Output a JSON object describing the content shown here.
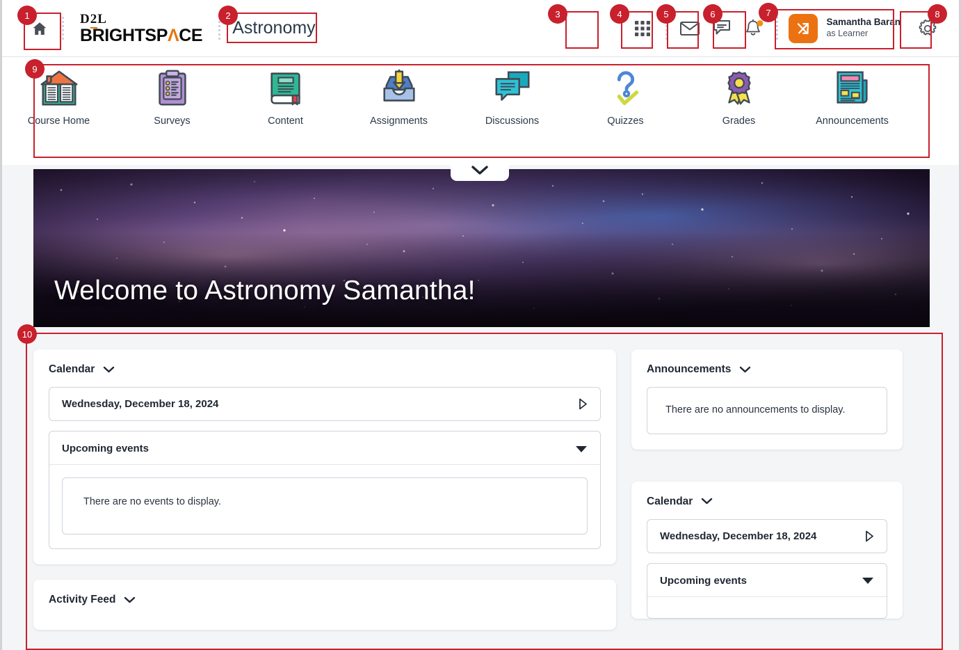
{
  "header": {
    "home_icon": "home-icon",
    "brand_top": "D2L",
    "brand_top_pre": "D",
    "brand_top_num": "2",
    "brand_top_post": "L",
    "brand_main_pre": "BRIGHTSP",
    "brand_main_acc": "A",
    "brand_main_post": "CE",
    "course_name": "Astronomy",
    "waffle_icon": "grid-apps-icon",
    "email_icon": "envelope-icon",
    "messages_icon": "chat-bubble-icon",
    "alerts_icon": "bell-icon",
    "user_name": "Samantha Baran",
    "user_role": "as Learner",
    "avatar_icon": "swap-arrows-icon",
    "settings_icon": "gear-icon"
  },
  "navbar": {
    "items": [
      {
        "label": "Course Home",
        "icon": "open-book-house-icon"
      },
      {
        "label": "Surveys",
        "icon": "clipboard-checklist-icon"
      },
      {
        "label": "Content",
        "icon": "closed-book-icon"
      },
      {
        "label": "Assignments",
        "icon": "inbox-tray-down-arrow-icon"
      },
      {
        "label": "Discussions",
        "icon": "speech-bubbles-icon"
      },
      {
        "label": "Quizzes",
        "icon": "question-mark-check-icon"
      },
      {
        "label": "Grades",
        "icon": "award-ribbon-icon"
      },
      {
        "label": "Announcements",
        "icon": "newspaper-icon"
      }
    ],
    "collapse_icon": "chevron-down-icon"
  },
  "banner": {
    "title": "Welcome to Astronomy Samantha!",
    "image_alt": "galaxy-nebula-image"
  },
  "widgets": {
    "calendar_left": {
      "title": "Calendar",
      "chevron_icon": "chevron-down-icon",
      "date": "Wednesday, December 18, 2024",
      "date_next_icon": "play-triangle-icon",
      "upcoming_label": "Upcoming events",
      "upcoming_caret_icon": "caret-down-filled-icon",
      "empty_text": "There are no events to display."
    },
    "activity_feed": {
      "title": "Activity Feed",
      "chevron_icon": "chevron-down-icon"
    },
    "announcements": {
      "title": "Announcements",
      "chevron_icon": "chevron-down-icon",
      "empty_text": "There are no announcements to display."
    },
    "calendar_right": {
      "title": "Calendar",
      "chevron_icon": "chevron-down-icon",
      "date": "Wednesday, December 18, 2024",
      "date_next_icon": "play-triangle-icon",
      "upcoming_label": "Upcoming events",
      "upcoming_caret_icon": "caret-down-filled-icon"
    }
  },
  "callouts": [
    {
      "n": "1"
    },
    {
      "n": "2"
    },
    {
      "n": "3"
    },
    {
      "n": "4"
    },
    {
      "n": "5"
    },
    {
      "n": "6"
    },
    {
      "n": "7"
    },
    {
      "n": "8"
    },
    {
      "n": "9"
    },
    {
      "n": "10"
    }
  ],
  "colors": {
    "callout_red": "#c8202d",
    "brand_orange": "#e87511",
    "avatar_orange": "#ec7211",
    "page_bg": "#f4f5f7"
  }
}
